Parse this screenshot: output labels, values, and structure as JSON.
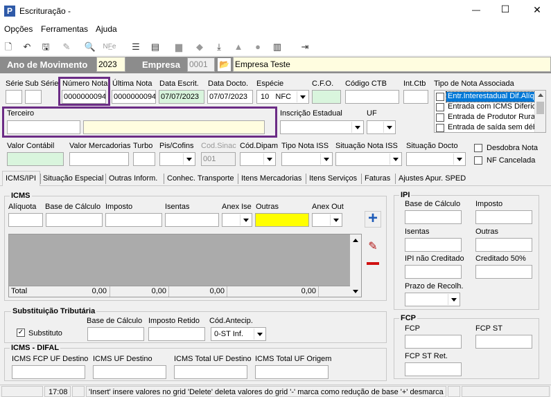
{
  "window": {
    "title": "Escrituração -",
    "minimize": "—",
    "maximize": "☐",
    "close": "✕"
  },
  "menu": [
    "Opções",
    "Ferramentas",
    "Ajuda"
  ],
  "toolbar": {
    "icons": [
      "new-icon",
      "undo-icon",
      "save-icon",
      "delete-icon",
      "print-preview-icon",
      "nfe-icon",
      "list-icon",
      "batch-icon",
      "folder-icon",
      "import-icon",
      "download-icon",
      "ticket-icon",
      "cfop-icon",
      "copy-icon",
      "exit-icon"
    ],
    "nfe_label": "NF̲e"
  },
  "header": {
    "ano_label": "Ano de Movimento",
    "ano_value": "2023",
    "empresa_label": "Empresa",
    "empresa_code": "0001",
    "empresa_name": "Empresa Teste"
  },
  "labels": {
    "serie": "Série",
    "subserie": "Sub Série",
    "numero_nota": "Número Nota",
    "ultima_nota": "Última Nota",
    "data_escrit": "Data Escrit.",
    "data_docto": "Data Docto.",
    "especie": "Espécie",
    "cfo": "C.F.O.",
    "codigo_ctb": "Código CTB",
    "int_ctb": "Int.Ctb",
    "tipo_nota_assoc": "Tipo de Nota Associada",
    "terceiro": "Terceiro",
    "inscricao_estadual": "Inscrição Estadual",
    "uf": "UF",
    "valor_contabil": "Valor Contábil",
    "valor_mercadorias": "Valor Mercadorias",
    "turbo": "Turbo",
    "pis_cofins": "Pis/Cofins",
    "cod_sinac": "Cod.Sinac",
    "cod_dipam": "Cód.Dipam",
    "tipo_nota_iss": "Tipo Nota ISS",
    "situacao_nota_iss": "Situação Nota ISS",
    "situacao_docto": "Situação Docto",
    "desdobra_nota": "Desdobra Nota",
    "nf_cancelada": "NF Cancelada"
  },
  "values": {
    "numero_nota": "0000000094",
    "ultima_nota": "0000000094",
    "data_escrit": "07/07/2023",
    "data_docto": "07/07/2023",
    "especie": "10   NFC",
    "cod_sinac": "001"
  },
  "tipo_nota_list": [
    "Entr.Interestadual Dif.Alíquota",
    "Entrada com ICMS Diferido",
    "Entrada de Produtor Rural",
    "Entrada de saída sem débito"
  ],
  "tabs": [
    {
      "label": "ICMS/IPI",
      "u": "I"
    },
    {
      "label": "Situação Especial",
      "u": "S"
    },
    {
      "label": "Outras Inform.",
      "u": "O"
    },
    {
      "label": "Conhec. Transporte",
      "u": "C"
    },
    {
      "label": "Itens Mercadorias",
      "u": "I"
    },
    {
      "label": "Itens Serviços",
      "u": "I"
    },
    {
      "label": "Faturas",
      "u": "F"
    },
    {
      "label": "Ajustes Apur. SPED",
      "u": "A"
    }
  ],
  "icms": {
    "title": "ICMS",
    "aliquota": "Alíquota",
    "base_calculo": "Base de Cálculo",
    "imposto": "Imposto",
    "isentas": "Isentas",
    "anex_ise": "Anex Ise",
    "outras": "Outras",
    "anex_out": "Anex Out",
    "total_label": "Total",
    "totals": [
      "0,00",
      "0,00",
      "0,00",
      "0,00"
    ]
  },
  "ipi": {
    "title": "IPI",
    "base_calculo": "Base de Cálculo",
    "imposto": "Imposto",
    "isentas": "Isentas",
    "outras": "Outras",
    "nao_creditado": "IPI não Creditado",
    "creditado_50": "Creditado 50%",
    "prazo_recolh": "Prazo de Recolh."
  },
  "st": {
    "title": "Substituição Tributária",
    "substituto": "Substituto",
    "base_calculo": "Base de Cálculo",
    "imposto_retido": "Imposto Retido",
    "cod_antecip": "Cód.Antecip.",
    "cod_antecip_value": "0-ST Inf."
  },
  "fcp": {
    "title": "FCP",
    "fcp": "FCP",
    "fcp_st": "FCP ST",
    "fcp_st_ret": "FCP ST Ret."
  },
  "difal": {
    "title": "ICMS - DIFAL",
    "fcp_uf_destino": "ICMS FCP UF Destino",
    "uf_destino": "ICMS UF Destino",
    "total_uf_destino": "ICMS Total UF Destino",
    "total_uf_origem": "ICMS Total UF Origem"
  },
  "status": {
    "time": "17:08",
    "message": "'Insert' insere valores no grid 'Delete' deleta valores do grid '-' marca como redução de base '+' desmarca re"
  },
  "colors": {
    "accent_border": "#6b2c85",
    "header_bar": "#8c8c8c",
    "yellow_field": "#ffff00"
  }
}
